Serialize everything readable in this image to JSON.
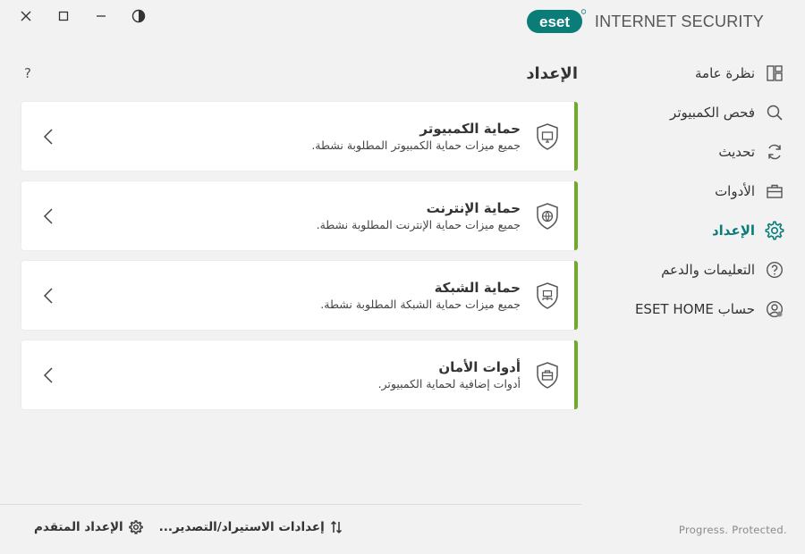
{
  "window": {
    "controls": [
      "close",
      "maximize",
      "minimize",
      "theme"
    ]
  },
  "brand": {
    "logo_text": "eset",
    "product": "INTERNET SECURITY"
  },
  "sidebar": {
    "items": [
      {
        "label": "نظرة عامة",
        "icon": "dashboard-icon"
      },
      {
        "label": "فحص الكمبيوتر",
        "icon": "search-icon"
      },
      {
        "label": "تحديث",
        "icon": "refresh-icon"
      },
      {
        "label": "الأدوات",
        "icon": "briefcase-icon"
      },
      {
        "label": "الإعداد",
        "icon": "gear-icon",
        "active": true
      },
      {
        "label": "التعليمات والدعم",
        "icon": "help-circle-icon"
      },
      {
        "label": "حساب ESET HOME",
        "icon": "account-icon"
      }
    ]
  },
  "main": {
    "title": "الإعداد",
    "help": "?",
    "cards": [
      {
        "title": "حماية الكمبيوتر",
        "subtitle": "جميع ميزات حماية الكمبيوتر المطلوبة نشطة.",
        "icon": "shield-monitor-icon"
      },
      {
        "title": "حماية الإنترنت",
        "subtitle": "جميع ميزات حماية الإنترنت المطلوبة نشطة.",
        "icon": "shield-globe-icon"
      },
      {
        "title": "حماية الشبكة",
        "subtitle": "جميع ميزات حماية الشبكة المطلوبة نشطة.",
        "icon": "shield-network-icon"
      },
      {
        "title": "أدوات الأمان",
        "subtitle": "أدوات إضافية لحماية الكمبيوتر.",
        "icon": "shield-toolbox-icon"
      }
    ]
  },
  "footer": {
    "import_export": "إعدادات الاستيراد/التصدير...",
    "advanced": "الإعداد المتقدم",
    "tagline": "Progress. Protected."
  },
  "colors": {
    "accent_teal": "#0a7d79",
    "status_green": "#6fa92d"
  }
}
